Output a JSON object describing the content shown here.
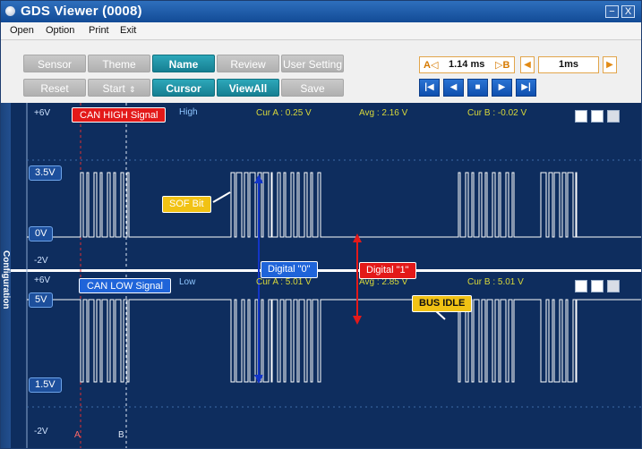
{
  "window": {
    "title": "GDS Viewer (0008)",
    "minimize_label": "−",
    "close_label": "X"
  },
  "menu": [
    "Open",
    "Option",
    "Print",
    "Exit"
  ],
  "toolbar": {
    "row1": [
      {
        "label": "Sensor",
        "active": false
      },
      {
        "label": "Theme",
        "active": false
      },
      {
        "label": "Name",
        "active": true
      },
      {
        "label": "Review",
        "active": false
      },
      {
        "label": "User Setting",
        "active": false
      }
    ],
    "row2": [
      {
        "label": "Reset",
        "active": false
      },
      {
        "label": "Start",
        "active": false
      },
      {
        "label": "Cursor",
        "active": true
      },
      {
        "label": "ViewAll",
        "active": true
      },
      {
        "label": "Save",
        "active": false
      }
    ],
    "start_spin": "⇕",
    "time_a_label": "A◁",
    "time_value": "1.14 ms",
    "time_b_label": "▷B",
    "zoom_left_arrow": "◀",
    "zoom_value": "1ms",
    "zoom_right_arrow": "▶",
    "nav_buttons": [
      "|◀",
      "◀",
      "■",
      "▶",
      "▶|"
    ]
  },
  "side_tab": "Configuration",
  "scope": {
    "channel_high": {
      "name": "CAN HIGH Signal",
      "mode": "High",
      "top_label": "+6V",
      "bottom_label": "-2V",
      "markers": [
        "3.5V",
        "0V"
      ],
      "cur_a": "Cur A : 0.25 V",
      "avg": "Avg : 2.16 V",
      "cur_b": "Cur B : -0.02 V"
    },
    "channel_low": {
      "name": "CAN LOW Signal",
      "mode": "Low",
      "top_label": "+6V",
      "bottom_label": "-2V",
      "markers": [
        "5V",
        "1.5V"
      ],
      "cur_a": "Cur A : 5.01 V",
      "avg": "Avg : 2.85 V",
      "cur_b": "Cur B : 5.01 V"
    },
    "callouts": {
      "sof": "SOF Bit",
      "digital0": "Digital \"0\"",
      "digital1": "Digital \"1\"",
      "bus_idle": "BUS IDLE"
    },
    "cursor_a": "A",
    "cursor_b": "B",
    "colors": {
      "background": "#0e2d5e",
      "trace": "#ffffff",
      "cursor_a": "#e03030",
      "cursor_b": "#dfe8f5",
      "digital0_arrow": "#1335c7",
      "digital1_arrow": "#e31919"
    }
  }
}
